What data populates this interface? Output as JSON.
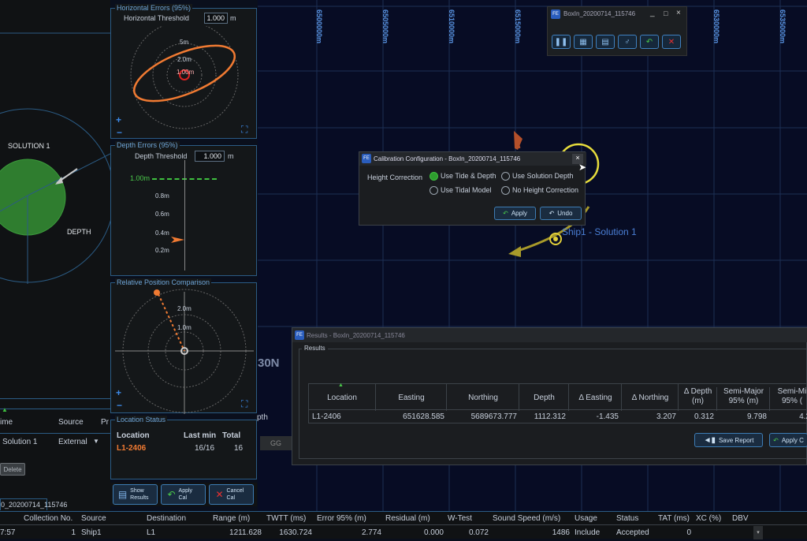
{
  "map": {
    "eastings": [
      "6500000m",
      "6505000m",
      "6510000m",
      "6515000m",
      "6520000m",
      "6525000m",
      "6530000m",
      "6535000m"
    ],
    "northing_label": "30N",
    "ship_label": "Ship1 - Solution 1"
  },
  "left": {
    "solution_label": "SOLUTION 1",
    "depth_label": "DEPTH",
    "table_headers": [
      "ime",
      "Source",
      "Pr"
    ],
    "table_row": [
      "Solution 1",
      "External"
    ],
    "delete_label": "Delete",
    "tab_label": "0_20200714_115746"
  },
  "horizontal": {
    "title": "Horizontal Errors (95%)",
    "threshold_label": "Horizontal Threshold",
    "threshold_value": "1.000",
    "unit": "m",
    "rings": [
      "5m",
      "2.0m",
      "1.00m"
    ]
  },
  "depth": {
    "title": "Depth Errors (95%)",
    "threshold_label": "Depth Threshold",
    "threshold_value": "1.000",
    "unit": "m",
    "line_label": "1.00m",
    "ticks": [
      "0.8m",
      "0.6m",
      "0.4m",
      "0.2m"
    ]
  },
  "relative": {
    "title": "Relative Position Comparison",
    "rings": [
      "2.0m",
      "1.0m"
    ]
  },
  "location_status": {
    "title": "Location Status",
    "headers": [
      "Location",
      "Last min",
      "Total"
    ],
    "row": [
      "L1-2406",
      "16/16",
      "16"
    ]
  },
  "bottom_buttons": {
    "show": "Show Results",
    "apply": "Apply Cal",
    "cancel": "Cancel Cal"
  },
  "mini_window": {
    "title": "BoxIn_20200714_115746"
  },
  "calib": {
    "title": "Calibration Configuration - BoxIn_20200714_115746",
    "height_correction": "Height Correction",
    "opt1": "Use Tide & Depth",
    "opt2": "Use Solution Depth",
    "opt3": "Use Tidal Model",
    "opt4": "No Height Correction",
    "apply": "Apply",
    "undo": "Undo"
  },
  "results": {
    "title": "Results - BoxIn_20200714_115746",
    "group": "Results",
    "headers": [
      "Location",
      "Easting",
      "Northing",
      "Depth",
      "Δ Easting",
      "Δ Northing",
      "Δ Depth (m)",
      "Semi-Major 95% (m)",
      "Semi-Mi 95% ("
    ],
    "row": [
      "L1-2406",
      "651628.585",
      "5689673.777",
      "1112.312",
      "-1.435",
      "3.207",
      "0.312",
      "9.798",
      "4.2"
    ],
    "save": "Save Report",
    "apply": "Apply C"
  },
  "bottom_table": {
    "depth_col": "pth",
    "gg": "GG",
    "headers": [
      "",
      "Collection No.",
      "Source",
      "Destination",
      "Range (m)",
      "TWTT (ms)",
      "Error 95% (m)",
      "Residual (m)",
      "W-Test",
      "Sound Speed (m/s)",
      "Usage",
      "Status",
      "TAT (ms)",
      "XC (%)",
      "DBV"
    ],
    "row": [
      "7:57",
      "1",
      "Ship1",
      "L1",
      "1211.628",
      "1630.724",
      "2.774",
      "0.000",
      "0.072",
      "1486",
      "Include",
      "Accepted",
      "0",
      "",
      ""
    ]
  },
  "colors": {
    "accent": "#3d7cb4",
    "ellipse": "#f07a32",
    "green": "#2f7d2f"
  }
}
